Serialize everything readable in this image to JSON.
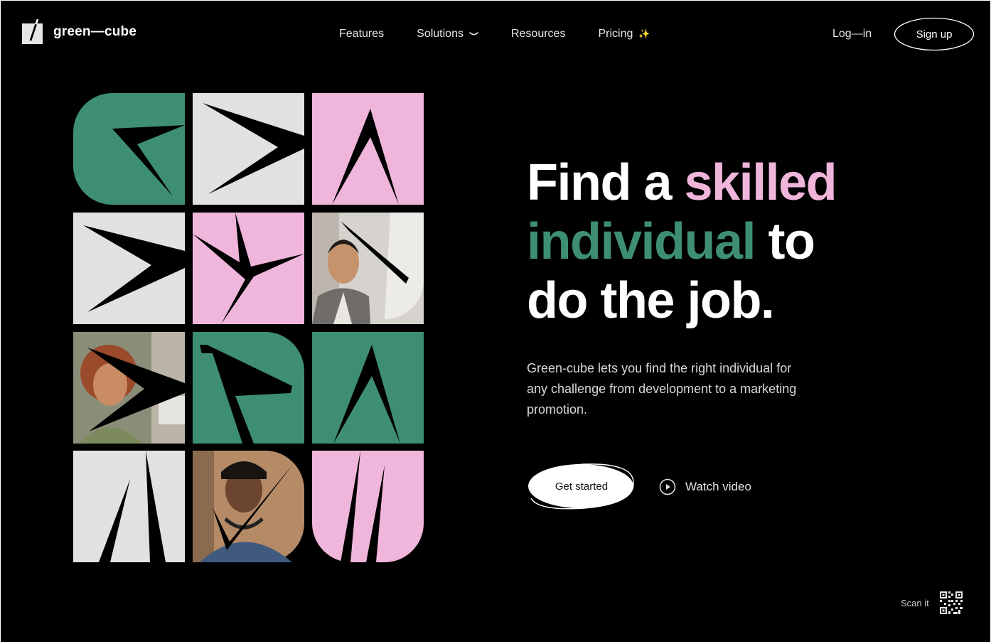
{
  "brand": {
    "name": "green—cube",
    "logo_icon": "slash-square-logo"
  },
  "nav": {
    "items": [
      {
        "label": "Features"
      },
      {
        "label": "Solutions",
        "icon": "chevron-down-icon"
      },
      {
        "label": "Resources"
      },
      {
        "label": "Pricing",
        "icon": "sparkle-icon"
      }
    ],
    "login_label": "Log—in",
    "signup_label": "Sign up"
  },
  "hero": {
    "headline": {
      "part1": "Find a ",
      "part2": "skilled",
      "part3": "individual",
      "part4": " to",
      "part5": "do the job."
    },
    "description": "Green-cube lets you find the right individual for any challenge from development to a marketing promotion.",
    "cta_label": "Get started",
    "watch_label": "Watch video"
  },
  "scan_label": "Scan it",
  "colors": {
    "background": "#000000",
    "green": "#3e8f72",
    "pink": "#f0b5db",
    "grey": "#e1e1e1"
  }
}
